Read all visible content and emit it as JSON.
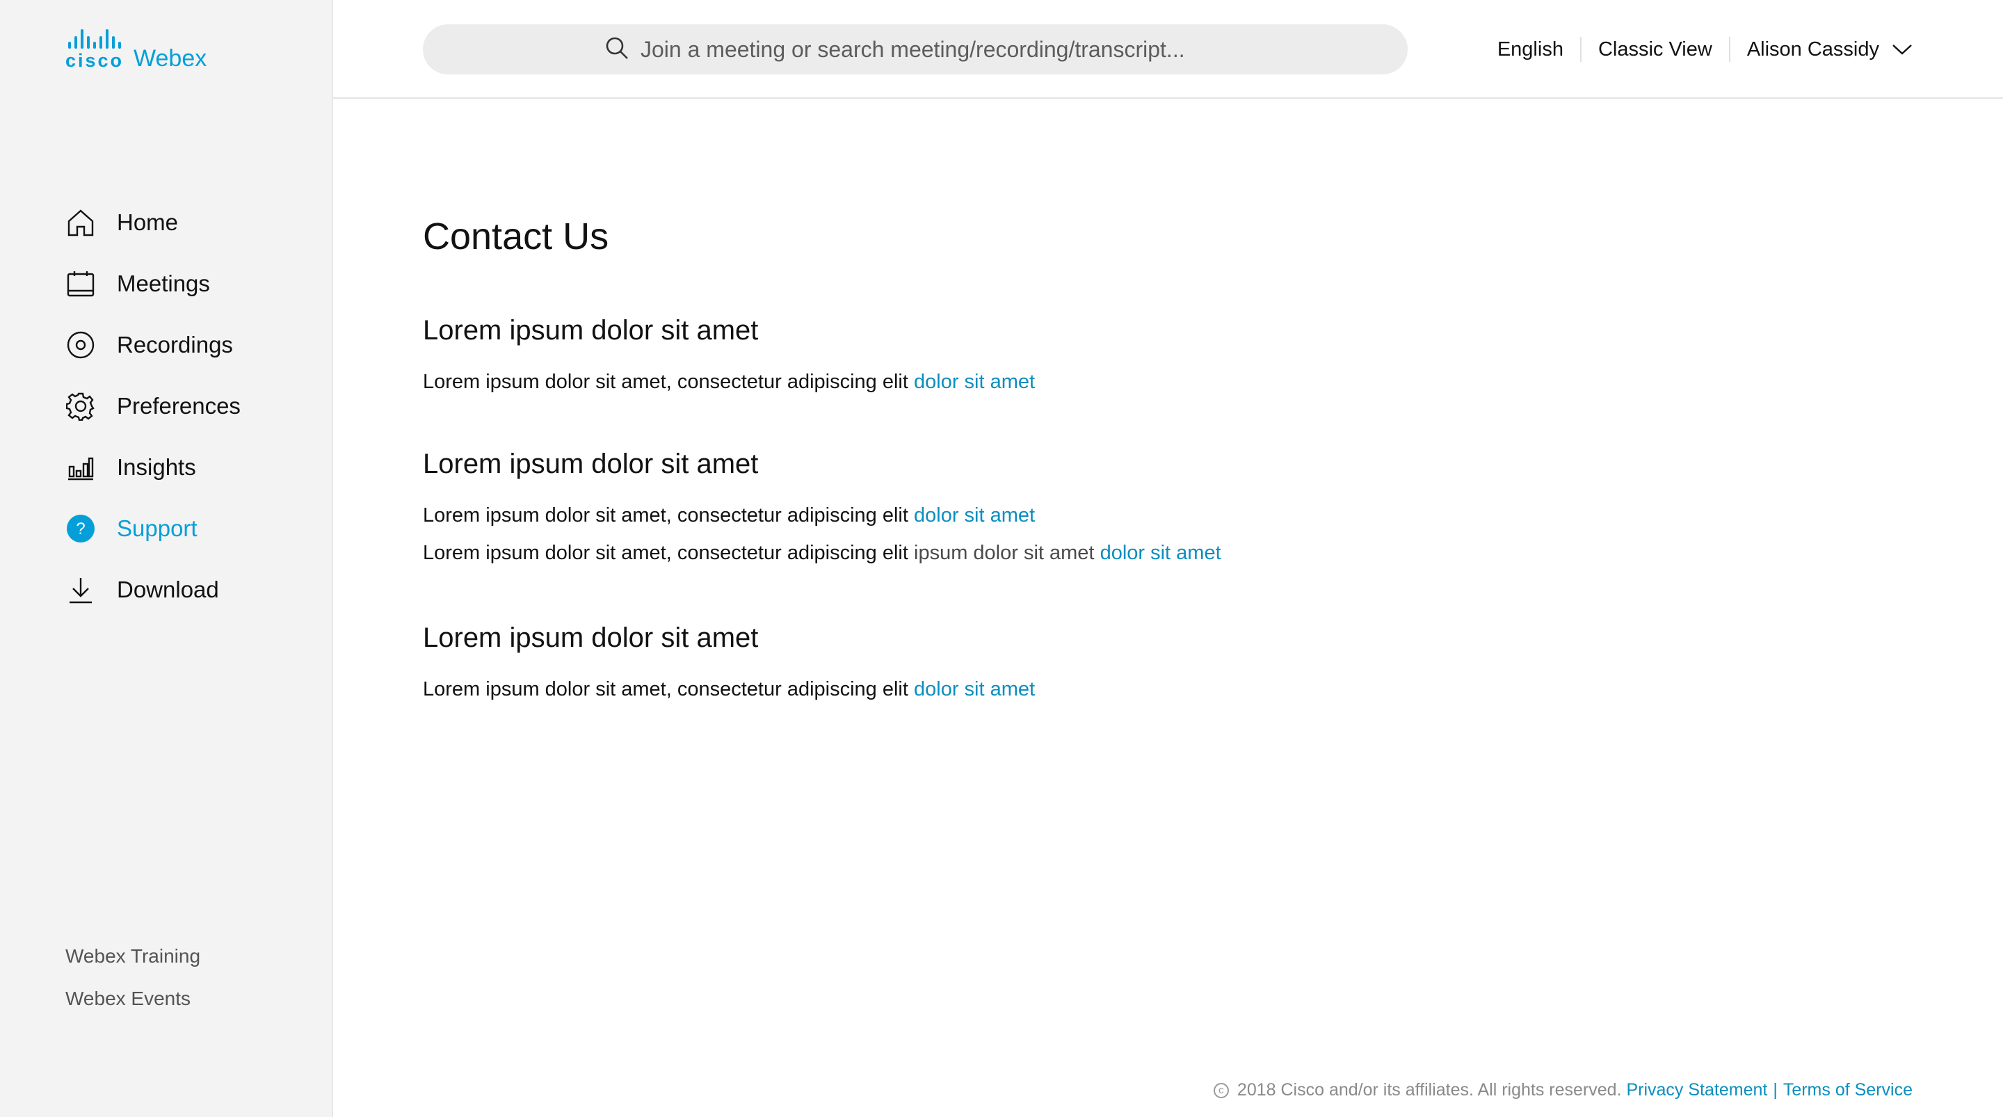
{
  "brand": {
    "cisco": "cisco",
    "product": "Webex",
    "color": "#049fd9"
  },
  "search": {
    "placeholder": "Join a meeting or search meeting/recording/transcript...",
    "icon": "search-icon"
  },
  "header": {
    "language": "English",
    "classic_view": "Classic View",
    "user_name": "Alison Cassidy"
  },
  "sidebar": {
    "items": [
      {
        "label": "Home",
        "icon": "home-icon",
        "active": false
      },
      {
        "label": "Meetings",
        "icon": "calendar-icon",
        "active": false
      },
      {
        "label": "Recordings",
        "icon": "recording-icon",
        "active": false
      },
      {
        "label": "Preferences",
        "icon": "gear-icon",
        "active": false
      },
      {
        "label": "Insights",
        "icon": "bar-chart-icon",
        "active": false
      },
      {
        "label": "Support",
        "icon": "help-icon",
        "active": true
      },
      {
        "label": "Download",
        "icon": "download-icon",
        "active": false
      }
    ],
    "links": [
      "Webex Training",
      "Webex Events"
    ]
  },
  "main": {
    "title": "Contact Us",
    "sections": [
      {
        "heading": "Lorem ipsum dolor sit amet",
        "lines": [
          {
            "text": "Lorem ipsum dolor sit amet, consectetur adipiscing elit",
            "link": "dolor sit amet"
          }
        ]
      },
      {
        "heading": "Lorem ipsum dolor sit amet",
        "lines": [
          {
            "text": "Lorem ipsum dolor sit amet, consectetur adipiscing elit",
            "link": "dolor sit amet"
          },
          {
            "text": "Lorem ipsum dolor sit amet, consectetur adipiscing elit",
            "muted": "ipsum dolor sit amet",
            "link": "dolor sit amet"
          }
        ]
      },
      {
        "heading": "Lorem ipsum dolor sit amet",
        "lines": [
          {
            "text": "Lorem ipsum dolor sit amet, consectetur adipiscing elit",
            "link": "dolor sit amet"
          }
        ]
      }
    ]
  },
  "footer": {
    "copyright": "2018 Cisco and/or its affiliates. All rights reserved.",
    "privacy": "Privacy Statement",
    "separator": "|",
    "terms": "Terms of Service"
  },
  "colors": {
    "accent": "#049fd9",
    "link": "#0b8ebf",
    "sidebar_bg": "#f3f3f3"
  }
}
